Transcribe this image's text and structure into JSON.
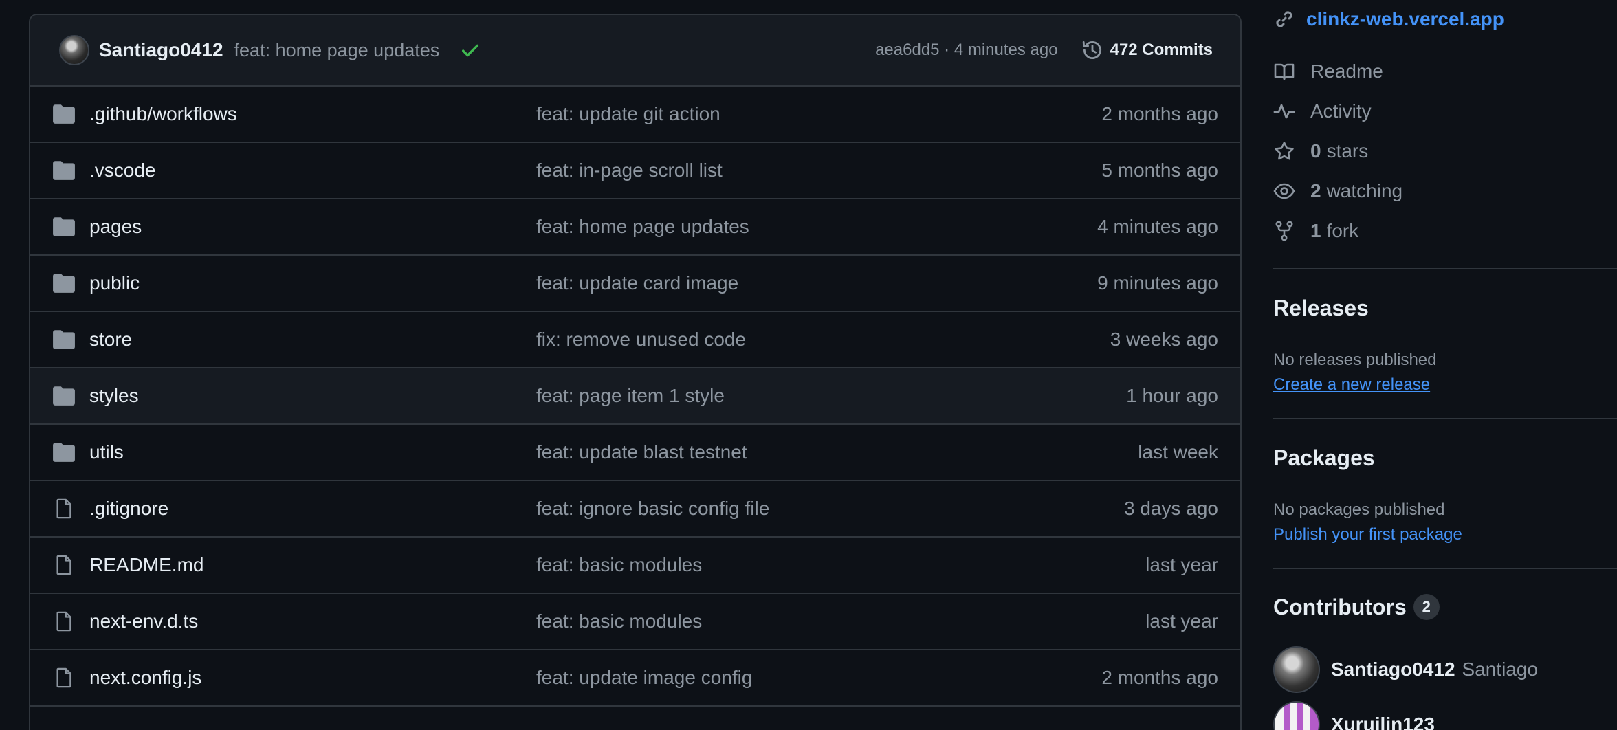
{
  "commit_bar": {
    "author": "Santiago0412",
    "message": "feat: home page updates",
    "meta": "aea6dd5 · 4 minutes ago",
    "commit_count": "472 Commits"
  },
  "files": [
    {
      "type": "folder",
      "name": ".github/workflows",
      "commit": "feat: update git action",
      "date": "2 months ago"
    },
    {
      "type": "folder",
      "name": ".vscode",
      "commit": "feat: in-page scroll list",
      "date": "5 months ago"
    },
    {
      "type": "folder",
      "name": "pages",
      "commit": "feat: home page updates",
      "date": "4 minutes ago"
    },
    {
      "type": "folder",
      "name": "public",
      "commit": "feat: update card image",
      "date": "9 minutes ago"
    },
    {
      "type": "folder",
      "name": "store",
      "commit": "fix: remove unused code",
      "date": "3 weeks ago"
    },
    {
      "type": "folder",
      "name": "styles",
      "commit": "feat: page item 1 style",
      "date": "1 hour ago"
    },
    {
      "type": "folder",
      "name": "utils",
      "commit": "feat: update blast testnet",
      "date": "last week"
    },
    {
      "type": "file",
      "name": ".gitignore",
      "commit": "feat: ignore basic config file",
      "date": "3 days ago"
    },
    {
      "type": "file",
      "name": "README.md",
      "commit": "feat: basic modules",
      "date": "last year"
    },
    {
      "type": "file",
      "name": "next-env.d.ts",
      "commit": "feat: basic modules",
      "date": "last year"
    },
    {
      "type": "file",
      "name": "next.config.js",
      "commit": "feat: update image config",
      "date": "2 months ago"
    }
  ],
  "sidebar": {
    "homepage": "clinkz-web.vercel.app",
    "readme": "Readme",
    "activity": "Activity",
    "stars_num": "0",
    "stars_label": "stars",
    "watching_num": "2",
    "watching_label": "watching",
    "fork_num": "1",
    "fork_label": "fork",
    "releases": {
      "title": "Releases",
      "empty_text": "No releases published",
      "link": "Create a new release"
    },
    "packages": {
      "title": "Packages",
      "empty_text": "No packages published",
      "link": "Publish your first package"
    },
    "contributors": {
      "title": "Contributors",
      "count": "2",
      "list": [
        {
          "login": "Santiago0412",
          "name": "Santiago"
        },
        {
          "login": "Xuruilin123",
          "name": ""
        }
      ]
    }
  },
  "colors": {
    "background": "#0d1117",
    "accent_link": "#4493f8",
    "success_check": "#3fb950",
    "muted_text": "#8d96a0"
  }
}
